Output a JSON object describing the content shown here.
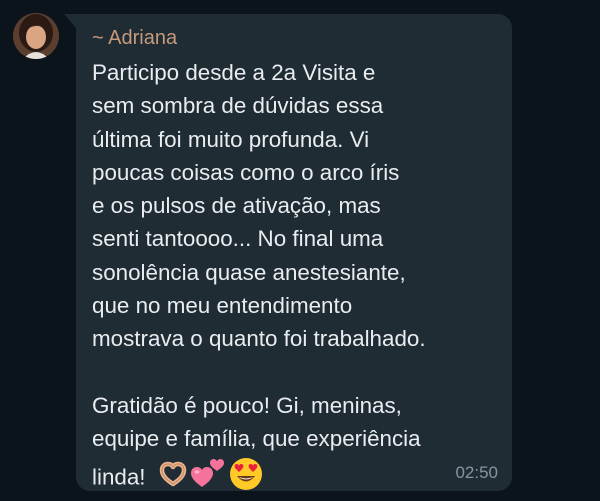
{
  "message": {
    "sender": "~ Adriana",
    "lines": [
      "Participo desde a 2a Visita e",
      "sem sombra de dúvidas essa",
      "última foi muito profunda. Vi",
      "poucas coisas como o arco íris",
      "e os pulsos de ativação, mas",
      "senti tantoooo... No final uma",
      "sonolência quase anestesiante,",
      "que no meu entendimento",
      "mostrava o quanto foi trabalhado."
    ],
    "lines2": [
      "Gratidão é pouco! Gi, meninas,",
      "equipe e família, que experiência"
    ],
    "last_line": "linda!",
    "emojis": [
      "heart-hands-icon",
      "two-hearts-icon",
      "heart-eyes-smiley-icon"
    ],
    "time": "02:50"
  },
  "colors": {
    "background": "#0b141a",
    "bubble": "#1f2c34",
    "sender": "#c79a7c",
    "text": "#e9edef",
    "timestamp": "#8696a0"
  }
}
